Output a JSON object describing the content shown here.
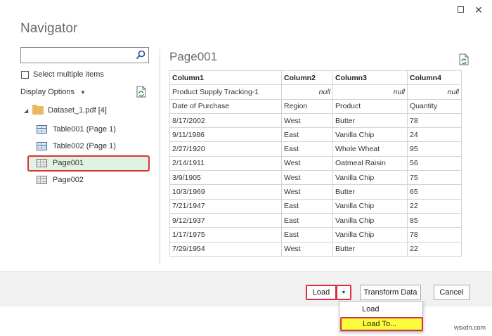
{
  "dialog": {
    "title": "Navigator"
  },
  "left_panel": {
    "search": {
      "value": "",
      "placeholder": ""
    },
    "select_multiple_label": "Select multiple items",
    "display_options_label": "Display Options",
    "tree": {
      "root_label": "Dataset_1.pdf [4]",
      "items": [
        {
          "label": "Table001 (Page 1)",
          "type": "table",
          "selected": false
        },
        {
          "label": "Table002 (Page 1)",
          "type": "table",
          "selected": false
        },
        {
          "label": "Page001",
          "type": "page",
          "selected": true
        },
        {
          "label": "Page002",
          "type": "page",
          "selected": false
        }
      ]
    }
  },
  "preview": {
    "title": "Page001",
    "columns": [
      "Column1",
      "Column2",
      "Column3",
      "Column4"
    ],
    "rows": [
      [
        "Product Supply Tracking-1",
        "null",
        "null",
        "null"
      ],
      [
        "Date of Purchase",
        "Region",
        "Product",
        "Quantity"
      ],
      [
        "8/17/2002",
        "West",
        "Butter",
        "78"
      ],
      [
        "9/11/1986",
        "East",
        "Vanilla Chip",
        "24"
      ],
      [
        "2/27/1920",
        "East",
        "Whole Wheat",
        "95"
      ],
      [
        "2/14/1911",
        "West",
        "Oatmeal Raisin",
        "56"
      ],
      [
        "3/9/1905",
        "West",
        "Vanilla Chip",
        "75"
      ],
      [
        "10/3/1969",
        "West",
        "Butter",
        "65"
      ],
      [
        "7/21/1947",
        "East",
        "Vanilla Chip",
        "22"
      ],
      [
        "9/12/1937",
        "East",
        "Vanilla Chip",
        "85"
      ],
      [
        "1/17/1975",
        "East",
        "Vanilla Chip",
        "78"
      ],
      [
        "7/29/1954",
        "West",
        "Butter",
        "22"
      ]
    ]
  },
  "footer": {
    "load_label": "Load",
    "transform_label": "Transform Data",
    "cancel_label": "Cancel"
  },
  "dropdown": {
    "items": [
      "Load",
      "Load To..."
    ]
  },
  "watermark": "wsxdn.com",
  "colors": {
    "highlight_border": "#d9333a",
    "selected_bg": "#dff3e3",
    "load_to_bg": "#fbfc3c"
  }
}
